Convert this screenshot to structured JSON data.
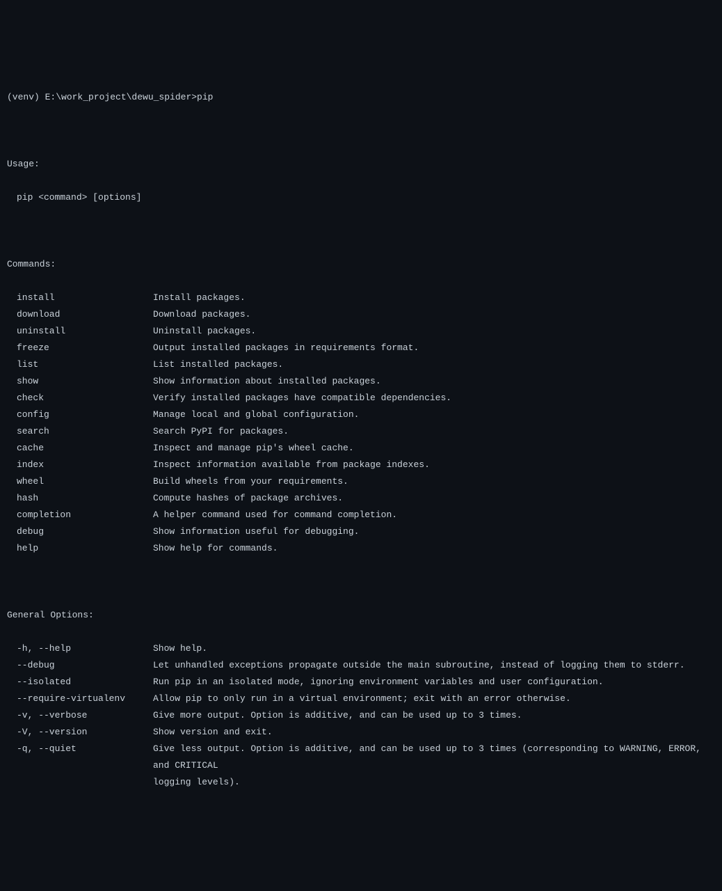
{
  "prompt": "(venv) E:\\work_project\\dewu_spider>pip",
  "usage_header": "Usage:",
  "usage_line": "pip <command> [options]",
  "commands_header": "Commands:",
  "commands": [
    {
      "name": "install",
      "desc": "Install packages."
    },
    {
      "name": "download",
      "desc": "Download packages."
    },
    {
      "name": "uninstall",
      "desc": "Uninstall packages."
    },
    {
      "name": "freeze",
      "desc": "Output installed packages in requirements format."
    },
    {
      "name": "list",
      "desc": "List installed packages."
    },
    {
      "name": "show",
      "desc": "Show information about installed packages."
    },
    {
      "name": "check",
      "desc": "Verify installed packages have compatible dependencies."
    },
    {
      "name": "config",
      "desc": "Manage local and global configuration."
    },
    {
      "name": "search",
      "desc": "Search PyPI for packages."
    },
    {
      "name": "cache",
      "desc": "Inspect and manage pip's wheel cache."
    },
    {
      "name": "index",
      "desc": "Inspect information available from package indexes."
    },
    {
      "name": "wheel",
      "desc": "Build wheels from your requirements."
    },
    {
      "name": "hash",
      "desc": "Compute hashes of package archives."
    },
    {
      "name": "completion",
      "desc": "A helper command used for command completion."
    },
    {
      "name": "debug",
      "desc": "Show information useful for debugging."
    },
    {
      "name": "help",
      "desc": "Show help for commands."
    }
  ],
  "options_header": "General Options:",
  "options": [
    {
      "name": "-h, --help",
      "desc": "Show help."
    },
    {
      "name": "--debug",
      "desc": "Let unhandled exceptions propagate outside the main subroutine, instead of logging them to stderr."
    },
    {
      "name": "--isolated",
      "desc": "Run pip in an isolated mode, ignoring environment variables and user configuration."
    },
    {
      "name": "--require-virtualenv",
      "desc": "Allow pip to only run in a virtual environment; exit with an error otherwise."
    },
    {
      "name": "-v, --verbose",
      "desc": "Give more output. Option is additive, and can be used up to 3 times."
    },
    {
      "name": "-V, --version",
      "desc": "Show version and exit."
    },
    {
      "name": "-q, --quiet",
      "desc": "Give less output. Option is additive, and can be used up to 3 times (corresponding to WARNING, ERROR, and CRITICAL",
      "cont": "logging levels)."
    }
  ]
}
